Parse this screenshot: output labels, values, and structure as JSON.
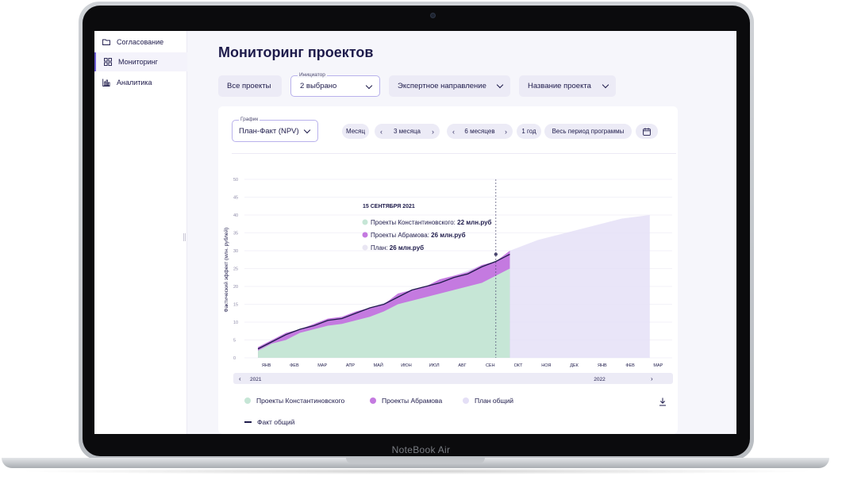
{
  "device": {
    "brand_label": "NoteBook Air"
  },
  "sidebar": {
    "items": [
      {
        "label": "Согласование",
        "icon": "folder-icon"
      },
      {
        "label": "Мониторинг",
        "icon": "grid-icon",
        "active": true
      },
      {
        "label": "Аналитика",
        "icon": "bar-chart-icon"
      }
    ]
  },
  "header": {
    "title": "Мониторинг проектов"
  },
  "filters": {
    "all_projects": "Все проекты",
    "initiator_label": "Инициатор",
    "initiator_value": "2 выбрано",
    "expert_direction": "Экспертное направление",
    "project_name": "Название проекта"
  },
  "controls": {
    "graph_label": "График",
    "graph_value": "План-Факт (NPV)",
    "period_month": "Месяц",
    "period_3m": "3 месяца",
    "period_6m": "6 месяцев",
    "period_year": "1 год",
    "period_all": "Весь период программы",
    "prev_arrow": "‹",
    "next_arrow": "›"
  },
  "tooltip": {
    "date": "15 СЕНТЯБРЯ 2021",
    "rows": [
      {
        "label": "Проекты Константиновского:",
        "value": "22 млн.руб",
        "color": "#c6e6d6"
      },
      {
        "label": "Проекты Абрамова:",
        "value": "26 млн.руб",
        "color": "#c47ae0"
      },
      {
        "label": "План:",
        "value": "26 млн.руб",
        "color": "#e9e6f3"
      }
    ]
  },
  "chart_data": {
    "type": "area",
    "ylabel": "Фактический эффект (млн. рублей)",
    "ylim": [
      0,
      50
    ],
    "yticks": [
      0,
      5,
      10,
      15,
      20,
      25,
      30,
      35,
      40,
      45,
      50
    ],
    "months": [
      "ЯНВ",
      "ФЕВ",
      "МАР",
      "АПР",
      "МАЙ",
      "ИЮН",
      "ИЮЛ",
      "АВГ",
      "СЕН",
      "ОКТ",
      "НОЯ",
      "ДЕК",
      "ЯНВ",
      "ФЕВ",
      "МАР"
    ],
    "years": [
      "2021",
      "2022"
    ],
    "grid": true,
    "legend_position": "bottom",
    "x": [
      0,
      0.5,
      1,
      1.5,
      2,
      2.5,
      3,
      3.5,
      4,
      4.5,
      5,
      5.5,
      6,
      6.5,
      7,
      7.5,
      8,
      8.5,
      9
    ],
    "series": [
      {
        "name": "Проекты Константиновского",
        "color": "#c6e6d6",
        "values": [
          2,
          4,
          5,
          7,
          8,
          9,
          9.5,
          10.5,
          11.5,
          13,
          15,
          16,
          17,
          18,
          19,
          20,
          21,
          23,
          25
        ]
      },
      {
        "name": "Проекты Абрамова",
        "color": "#c47ae0",
        "values": [
          3,
          5,
          7,
          8,
          9.5,
          11,
          11.5,
          13,
          14,
          15,
          18,
          19,
          20,
          22,
          23,
          24,
          26,
          27,
          30
        ]
      },
      {
        "name": "План общий",
        "color": "#e4dff6",
        "x": [
          0,
          1,
          2,
          3,
          4,
          5,
          6,
          7,
          8,
          8.5,
          9,
          10,
          11,
          12,
          13,
          14
        ],
        "values": [
          3,
          6,
          9,
          11,
          14,
          17,
          20,
          23,
          26,
          27,
          30,
          33,
          35,
          37,
          39,
          40
        ]
      },
      {
        "name": "Факт общий",
        "color": "#1e1b4b",
        "values": [
          2.5,
          4.5,
          6.5,
          8,
          9,
          10.5,
          11,
          12.5,
          14,
          15,
          17,
          19,
          20,
          21,
          22.5,
          23.5,
          25.5,
          27,
          29
        ]
      }
    ],
    "marker": {
      "x": 8.5,
      "y": 29
    }
  }
}
